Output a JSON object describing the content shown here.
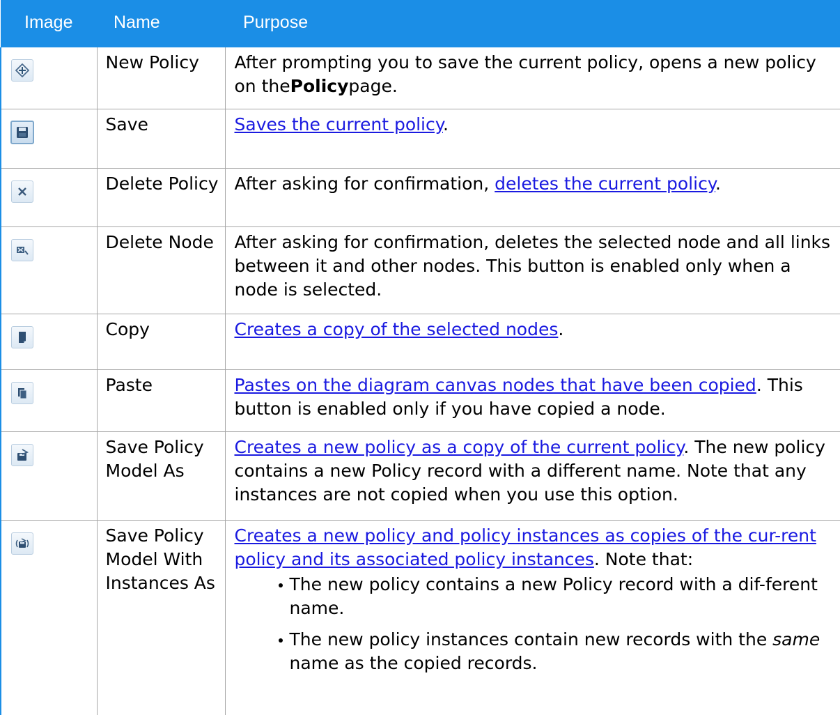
{
  "header": {
    "image": "Image",
    "name": "Name",
    "purpose": "Purpose"
  },
  "rows": [
    {
      "icon": "new-policy-icon",
      "name": "New Policy",
      "purpose": {
        "before": "After prompting you to save the current policy, opens a new policy on the",
        "bold": "Policy",
        "after": "page."
      }
    },
    {
      "icon": "save-icon",
      "name": "Save",
      "purpose": {
        "link": "Saves the current policy",
        "after": "."
      }
    },
    {
      "icon": "delete-icon",
      "name": "Delete Policy",
      "purpose": {
        "before": "After asking for confirmation, ",
        "link": "deletes the current policy",
        "after": "."
      }
    },
    {
      "icon": "delete-node-icon",
      "name": "Delete Node",
      "purpose": {
        "text": "After asking for confirmation, deletes the selected node and all links between it and other nodes. This button is enabled only when a node is selected."
      }
    },
    {
      "icon": "copy-icon",
      "name": "Copy",
      "purpose": {
        "link": "Creates a copy of the selected nodes",
        "after": "."
      }
    },
    {
      "icon": "paste-icon",
      "name": "Paste",
      "purpose": {
        "link": "Pastes on the diagram canvas nodes that have been copied",
        "after": ". This button is enabled only if you have copied a node."
      }
    },
    {
      "icon": "save-as-icon",
      "name": "Save Policy Model As",
      "purpose": {
        "link": "Creates a new policy as a copy of the current policy",
        "after": ". The new policy contains a new Policy record with a different name. Note that any instances are not copied when you use this option."
      }
    },
    {
      "icon": "save-with-instances-icon",
      "name": "Save Policy Model With Instances As",
      "purpose": {
        "link": "Creates a new policy and policy instances as copies of the cur-rent policy and its associated policy instances",
        "after": ". Note that:",
        "bullets": [
          {
            "text": "The new policy contains a new Policy record with a dif-ferent name."
          },
          {
            "before": "The new policy instances contain new records with the ",
            "italic": "same",
            "after": " name as the copied records."
          }
        ]
      }
    }
  ]
}
